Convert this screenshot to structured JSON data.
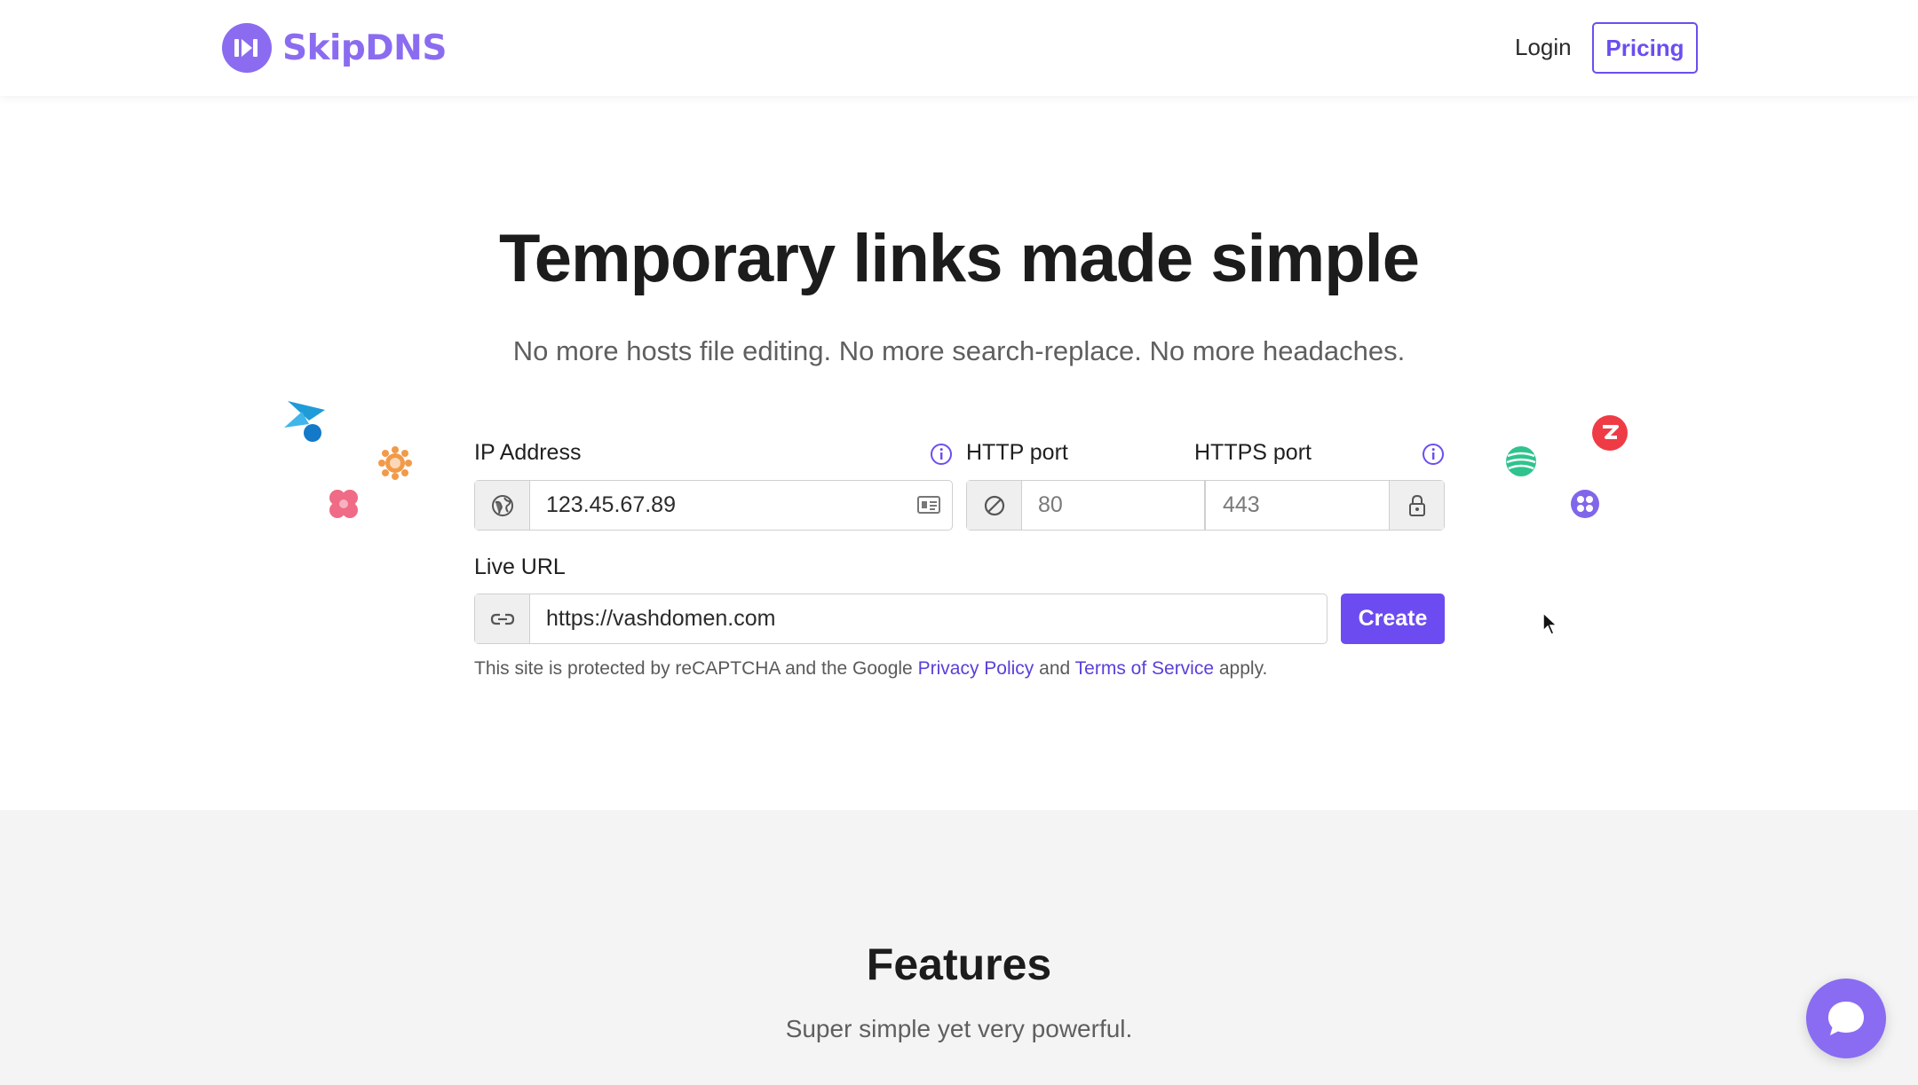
{
  "header": {
    "brand": "SkipDNS",
    "login_label": "Login",
    "pricing_label": "Pricing",
    "brand_color": "#8b6cf0",
    "accent_color": "#6b4ef0"
  },
  "hero": {
    "title": "Temporary links made simple",
    "subtitle": "No more hosts file editing. No more search-replace. No more headaches."
  },
  "form": {
    "ip_label": "IP Address",
    "ip_value": "123.45.67.89",
    "http_label": "HTTP port",
    "http_value": "80",
    "https_label": "HTTPS port",
    "https_value": "443",
    "live_url_label": "Live URL",
    "live_url_value": "https://vashdomen.com",
    "create_label": "Create",
    "legal_prefix": "This site is protected by reCAPTCHA and the Google",
    "privacy_link": "Privacy Policy",
    "legal_and": "and",
    "terms_link": "Terms of Service",
    "legal_suffix": "apply."
  },
  "features": {
    "title": "Features",
    "subtitle": "Super simple yet very powerful."
  },
  "icons": {
    "brand": "skip-forward-icon",
    "ip_addon": "globe-icon",
    "ip_trailing": "id-card-icon",
    "http_addon": "no-symbol-icon",
    "https_addon": "lock-icon",
    "url_addon": "link-icon",
    "info": "info-icon",
    "chat": "chat-bubble-icon"
  }
}
